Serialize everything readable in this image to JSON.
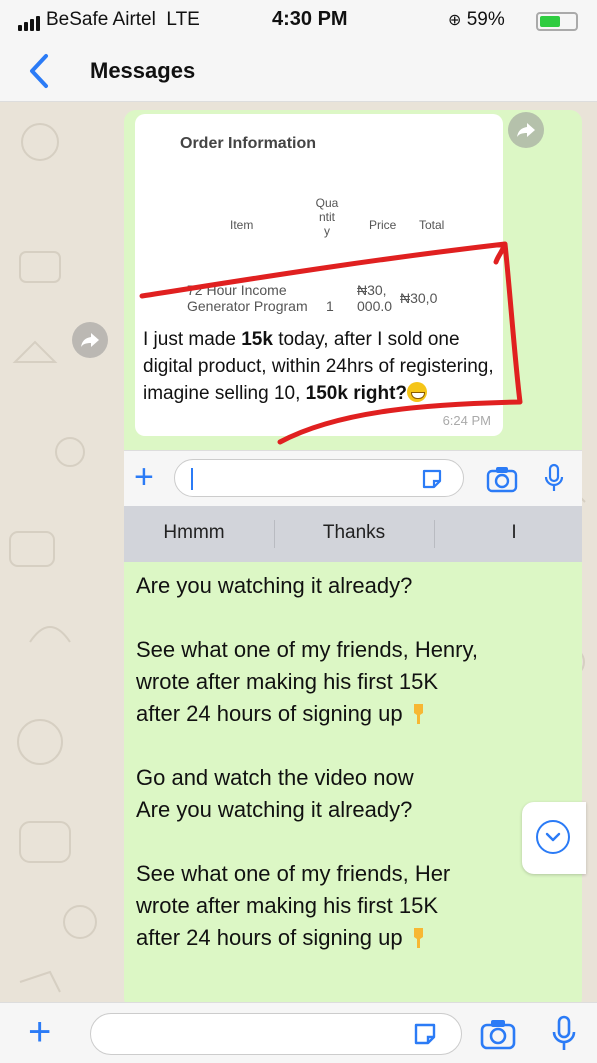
{
  "status_bar": {
    "carrier": "BeSafe Airtel",
    "network": "LTE",
    "time": "4:30 PM",
    "battery_percent": "59%",
    "battery_level": 0.59
  },
  "nav": {
    "back_icon": "chevron-left-icon",
    "title": "Messages"
  },
  "forwarded_message": {
    "order_title": "Order Information",
    "table_headers": [
      "Item",
      "Qua\nntit\ny",
      "Price",
      "Total"
    ],
    "row": {
      "item": "72 Hour Income\nGenerator Program",
      "quantity": "1",
      "price": "₦30,\n000.0",
      "total": "₦30,0"
    },
    "text_parts": [
      {
        "t": "I just made ",
        "b": false
      },
      {
        "t": "15k",
        "b": true
      },
      {
        "t": " today, after I sold one digital product, within 24hrs of registering, imagine selling 10, ",
        "b": false
      },
      {
        "t": "150k right?",
        "b": true
      }
    ],
    "time": "6:24 PM",
    "forward_icon": "forward-icon"
  },
  "keyboard": {
    "input_value": "",
    "suggestions": [
      "Hmmm",
      "Thanks",
      "I"
    ],
    "icons": [
      "plus-icon",
      "sticker-icon",
      "camera-icon",
      "microphone-icon"
    ]
  },
  "message_lines": [
    "Are you watching it already?",
    "",
    "See what one of my friends, Henry,",
    "wrote after making his first 15K",
    "after 24 hours of signing up",
    "",
    "Go and watch the video now",
    "Are you watching it already?",
    "",
    "See what one of my friends, Her",
    "wrote after making his first 15K",
    "after 24 hours of signing up"
  ],
  "bottom_bar": {
    "input_value": "",
    "icons": [
      "plus-icon",
      "sticker-icon",
      "camera-icon",
      "microphone-icon"
    ]
  },
  "colors": {
    "accent": "#2b7bf6",
    "outgoing_bubble": "#dcf7c5",
    "annotation_red": "#e02020"
  }
}
